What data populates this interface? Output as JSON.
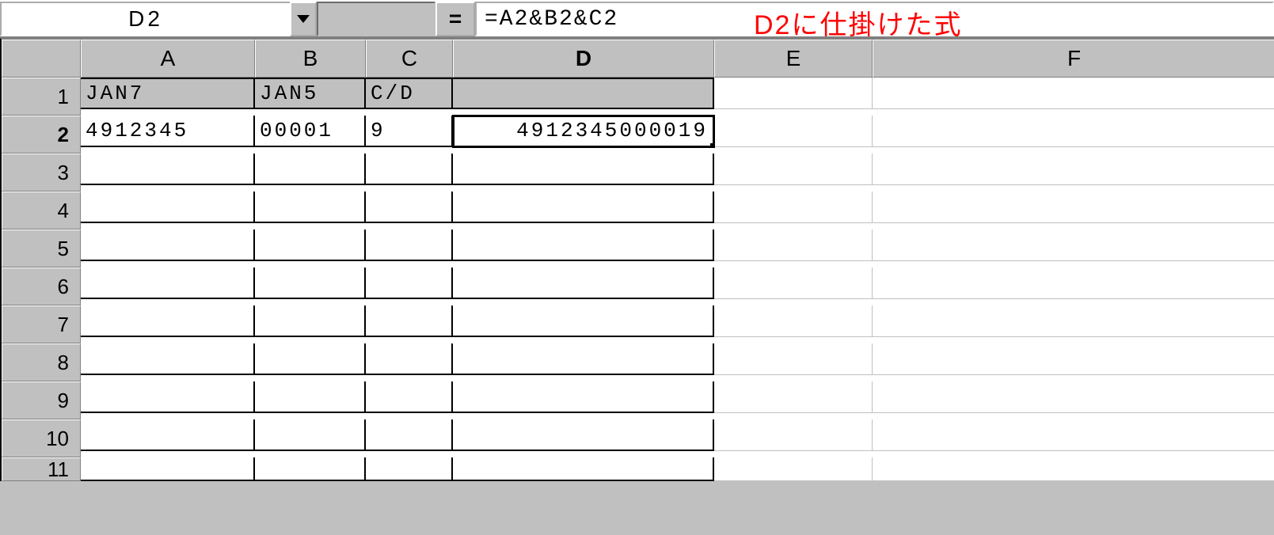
{
  "formulaBar": {
    "nameBox": "D2",
    "equals": "=",
    "formula": "=A2&B2&C2",
    "annotation": "D2に仕掛けた式"
  },
  "columns": [
    "A",
    "B",
    "C",
    "D",
    "E",
    "F"
  ],
  "activeColumn": "D",
  "activeRow": "2",
  "rowNumbers": [
    "1",
    "2",
    "3",
    "4",
    "5",
    "6",
    "7",
    "8",
    "9",
    "10",
    "11"
  ],
  "cells": {
    "A1": "JAN7",
    "B1": "JAN5",
    "C1": "C/D",
    "D1": "",
    "A2": "4912345",
    "B2": "00001",
    "C2": "9",
    "D2": "4912345000019"
  }
}
